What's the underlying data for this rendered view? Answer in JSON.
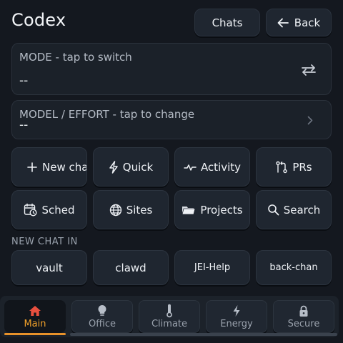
{
  "header": {
    "title": "Codex",
    "chats_label": "Chats",
    "back_label": "Back"
  },
  "mode": {
    "label": "MODE - tap to switch",
    "value": "--"
  },
  "model": {
    "label": "MODEL / EFFORT - tap to change",
    "value": "--"
  },
  "actions": [
    {
      "label": "New chat",
      "icon": "plus-icon"
    },
    {
      "label": "Quick",
      "icon": "lightning-icon"
    },
    {
      "label": "Activity",
      "icon": "pulse-icon"
    },
    {
      "label": "PRs",
      "icon": "git-compare-icon"
    },
    {
      "label": "Sched",
      "icon": "calendar-clock-icon"
    },
    {
      "label": "Sites",
      "icon": "globe-icon"
    },
    {
      "label": "Projects",
      "icon": "folder-icon"
    },
    {
      "label": "Search",
      "icon": "search-icon"
    }
  ],
  "new_chat_in": {
    "heading": "NEW CHAT IN",
    "items": [
      "vault",
      "clawd",
      "JEI-Help",
      "back-chan"
    ]
  },
  "bottom_nav": {
    "active_index": 0,
    "items": [
      {
        "label": "Main",
        "icon": "home-icon"
      },
      {
        "label": "Office",
        "icon": "lightbulb-icon"
      },
      {
        "label": "Climate",
        "icon": "thermometer-icon"
      },
      {
        "label": "Energy",
        "icon": "lightning-icon"
      },
      {
        "label": "Secure",
        "icon": "lock-icon"
      }
    ]
  },
  "colors": {
    "background": "#14181f",
    "accent": "#f0a02a",
    "card": "#1f2630"
  }
}
